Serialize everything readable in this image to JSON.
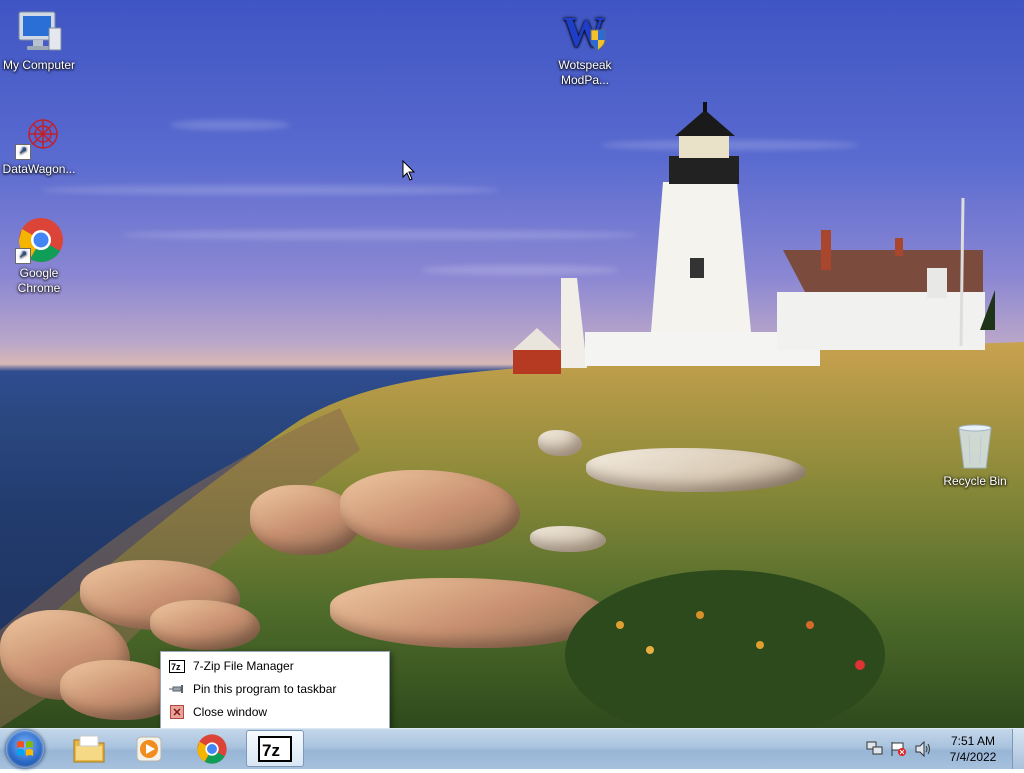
{
  "desktop": {
    "icons": [
      {
        "id": "my-computer",
        "label": "My Computer"
      },
      {
        "id": "datawagon",
        "label": "DataWagon..."
      },
      {
        "id": "google-chrome",
        "label_line1": "Google",
        "label_line2": "Chrome"
      },
      {
        "id": "wotspeak",
        "label_line1": "Wotspeak",
        "label_line2": "ModPa..."
      },
      {
        "id": "recycle-bin",
        "label": "Recycle Bin"
      }
    ]
  },
  "jumplist": {
    "items": [
      {
        "label": "7-Zip File Manager",
        "icon": "7zip-icon"
      },
      {
        "label": "Pin this program to taskbar",
        "icon": "pin-icon"
      },
      {
        "label": "Close window",
        "icon": "close-icon"
      }
    ]
  },
  "taskbar": {
    "buttons": [
      "start-orb",
      "windows-explorer",
      "media-player",
      "google-chrome",
      "7-zip-file-manager"
    ],
    "active": "7-zip-file-manager",
    "sevenzip_glyph": "7z",
    "tray_icons": [
      "network-icon",
      "action-center-flag-icon",
      "volume-icon"
    ],
    "clock": {
      "time": "7:51 AM",
      "date": "7/4/2022"
    }
  },
  "colors": {
    "taskbar": "#a9c3de",
    "sky": "#3f55c3",
    "sea": "#223c6e",
    "chrome_red": "#db4437",
    "chrome_green": "#0f9d58",
    "chrome_yellow": "#f4b400",
    "chrome_blue": "#4285f4"
  }
}
